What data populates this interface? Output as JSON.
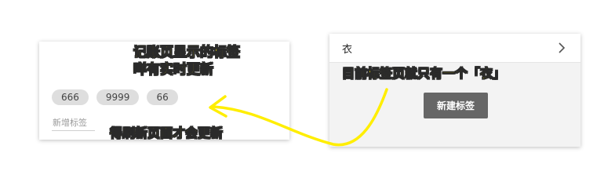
{
  "left_panel": {
    "tags": [
      "666",
      "9999",
      "66"
    ],
    "new_tag_placeholder": "新增标签"
  },
  "right_panel": {
    "tag_item_label": "衣",
    "create_button_label": "新建标签"
  },
  "annotations": {
    "note_left_line1": "记账页显示的标签",
    "note_left_line2": "咩有实时更新",
    "note_bottom": "得刷新页面才会更新",
    "note_right": "目前标签页就只有一个「衣」"
  },
  "colors": {
    "annotation_text": "#ffee00",
    "arrow": "#ffee00",
    "button_bg": "#666666",
    "tag_chip_bg": "#dedede"
  }
}
